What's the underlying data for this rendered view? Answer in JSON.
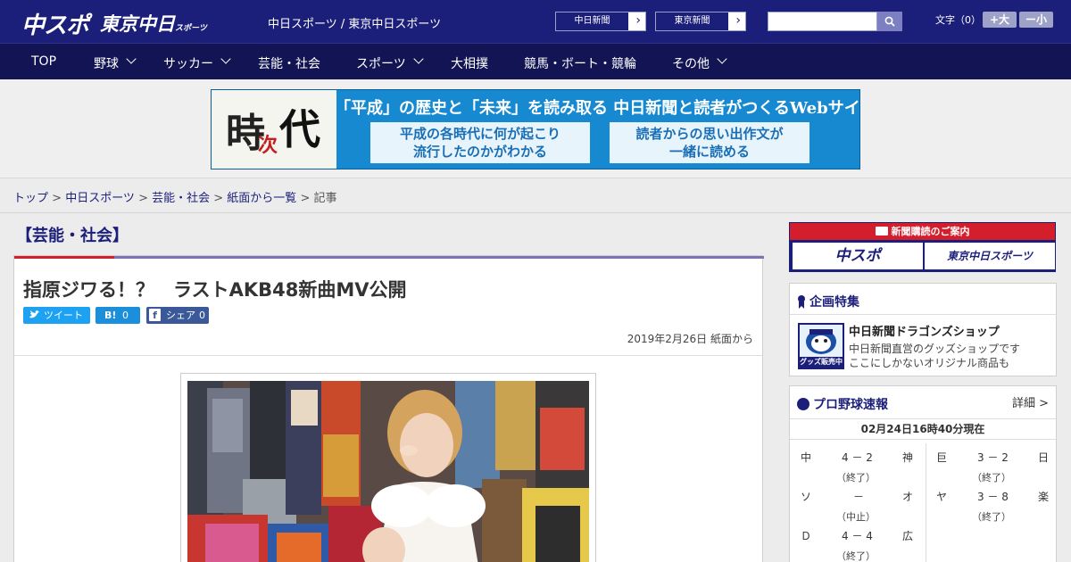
{
  "header": {
    "logo_chuspo": "中スポ",
    "logo_tokyo": "東京中日",
    "logo_tokyo_sub": "スポーツ",
    "site_title": "中日スポーツ / 東京中日スポーツ",
    "paper_buttons": [
      "中日新聞",
      "東京新聞"
    ],
    "font_label": "文字（0）",
    "font_plus": "+大",
    "font_minus": "ー小",
    "search_value": ""
  },
  "nav": {
    "items": [
      "TOP",
      "野球",
      "サッカー",
      "芸能・社会",
      "スポーツ",
      "大相撲",
      "競馬・ボート・競輪",
      "その他"
    ]
  },
  "ad": {
    "char1": "時",
    "char2": "次",
    "char3": "代",
    "headline": "「平成」の歴史と「未来」を読み取る 中日新聞と読者がつくるWebサイト",
    "box1_line1": "平成の各時代に何が起こり",
    "box1_line2": "流行したのかがわかる",
    "box2_line1": "読者からの思い出作文が",
    "box2_line2": "一緒に読める"
  },
  "breadcrumb": {
    "items": [
      "トップ",
      "中日スポーツ",
      "芸能・社会",
      "紙面から一覧"
    ],
    "current": "記事"
  },
  "article": {
    "category": "【芸能・社会】",
    "title": "指原ジワる！？　ラストAKB48新曲MV公開",
    "share_tweet": "ツイート",
    "share_hatena_icon": "B!",
    "share_hatena_count": "0",
    "share_fb_icon": "f",
    "share_fb_label": "シェア",
    "share_fb_count": "0",
    "date": "2019年2月26日 紙面から"
  },
  "sidebar": {
    "subscribe_head": "新聞購読のご案内",
    "subscribe_logos": [
      "中スポ",
      "東京中日スポーツ"
    ],
    "kikaku_title": "企画特集",
    "shop_name": "中日新聞ドラゴンズショップ",
    "shop_desc1": "中日新聞直営のグッズショップです",
    "shop_desc2": "ここにしかないオリジナル商品も",
    "shop_icon_label": "グッズ販売中",
    "baseball_title": "プロ野球速報",
    "baseball_detail": "詳細 >",
    "baseball_time": "02月24日16時40分現在",
    "games": [
      {
        "home": "中",
        "score": "4 － 2",
        "away": "神",
        "status": "（終了）"
      },
      {
        "home": "巨",
        "score": "3 － 2",
        "away": "日",
        "status": "（終了）"
      },
      {
        "home": "ソ",
        "score": "－",
        "away": "オ",
        "status": "（中止）"
      },
      {
        "home": "ヤ",
        "score": "3 － 8",
        "away": "楽",
        "status": "（終了）"
      },
      {
        "home": "Ｄ",
        "score": "4 － 4",
        "away": "広",
        "status": "（終了）"
      }
    ]
  },
  "colors": {
    "brand_navy": "#1c1f7a",
    "nav_dark": "#121453",
    "accent_red": "#d0212b",
    "ad_blue": "#1689d0"
  }
}
